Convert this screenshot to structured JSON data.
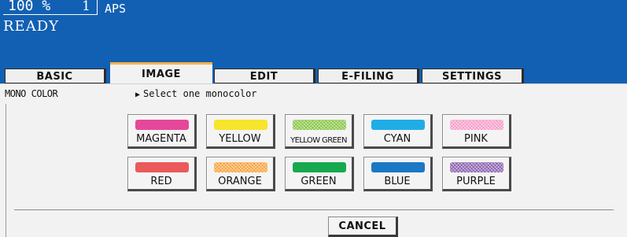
{
  "status": {
    "zoom_value": "100  %",
    "copy_count": "1",
    "paper_mode": "APS",
    "machine_status": "READY"
  },
  "tabs": [
    {
      "label": "BASIC",
      "active": false
    },
    {
      "label": "IMAGE",
      "active": true
    },
    {
      "label": "EDIT",
      "active": false
    },
    {
      "label": "E-FILING",
      "active": false
    },
    {
      "label": "SETTINGS",
      "active": false
    }
  ],
  "function": {
    "label": "MONO COLOR",
    "hint_icon": "triangle-right-icon",
    "hint": "Select one monocolor"
  },
  "colors": [
    {
      "label": "MAGENTA",
      "swatch": "#e5489a"
    },
    {
      "label": "YELLOW",
      "swatch": "#f6e52c"
    },
    {
      "label": "YELLOW GREEN",
      "swatch": "#86c443"
    },
    {
      "label": "CYAN",
      "swatch": "#20ade6"
    },
    {
      "label": "PINK",
      "swatch": "#f59bc8"
    },
    {
      "label": "RED",
      "swatch": "#ea5a5c"
    },
    {
      "label": "ORANGE",
      "swatch": "#f7a13b"
    },
    {
      "label": "GREEN",
      "swatch": "#17a94e"
    },
    {
      "label": "BLUE",
      "swatch": "#1b78c4"
    },
    {
      "label": "PURPLE",
      "swatch": "#8a60ad"
    }
  ],
  "actions": {
    "cancel_label": "CANCEL"
  },
  "theme": {
    "header_blue": "#1260b3",
    "active_tab_accent": "#f6b24a"
  }
}
